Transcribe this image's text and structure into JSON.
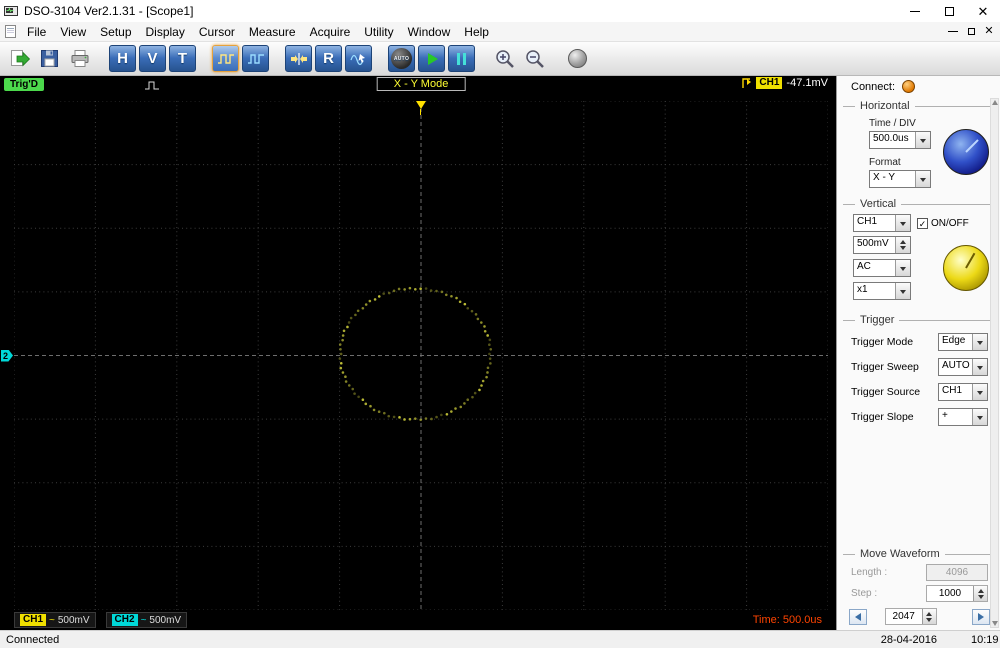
{
  "window": {
    "title": "DSO-3104 Ver2.1.31 - [Scope1]"
  },
  "menu": {
    "items": [
      "File",
      "View",
      "Setup",
      "Display",
      "Cursor",
      "Measure",
      "Acquire",
      "Utility",
      "Window",
      "Help"
    ]
  },
  "toolbar": {
    "h_label": "H",
    "v_label": "V",
    "t_label": "T",
    "r_label": "R",
    "auto_label": "AUTO"
  },
  "scope": {
    "trig_status": "Trig'D",
    "mode_label": "X - Y Mode",
    "trigger_readout": {
      "channel": "CH1",
      "value": "-47.1mV"
    },
    "marker2": "2",
    "channels": [
      {
        "label": "CH1",
        "coupling": "~",
        "volts": "500mV"
      },
      {
        "label": "CH2",
        "coupling": "~",
        "volts": "500mV"
      }
    ],
    "time_label": "Time: 500.0us",
    "grid": {
      "cols": 10,
      "rows": 8,
      "dot_color": "#3d3d3d",
      "center_color": "#6e6e6e",
      "bg": "#000000"
    },
    "waveform": {
      "type": "xy-ellipse",
      "color": "#c9c93a",
      "cx": 0.493,
      "cy": 0.497,
      "rx": 0.0925,
      "ry": 0.129,
      "points": 88
    }
  },
  "panel": {
    "connect_label": "Connect:",
    "horizontal": {
      "title": "Horizontal",
      "time_div_label": "Time / DIV",
      "time_div_value": "500.0us",
      "format_label": "Format",
      "format_value": "X - Y"
    },
    "vertical": {
      "title": "Vertical",
      "channel_value": "CH1",
      "onoff_label": "ON/OFF",
      "volts_value": "500mV",
      "coupling_value": "AC",
      "probe_value": "x1"
    },
    "trigger": {
      "title": "Trigger",
      "rows": [
        {
          "label": "Trigger Mode",
          "value": "Edge"
        },
        {
          "label": "Trigger Sweep",
          "value": "AUTO"
        },
        {
          "label": "Trigger Source",
          "value": "CH1"
        },
        {
          "label": "Trigger Slope",
          "value": "+"
        }
      ]
    },
    "move": {
      "title": "Move Waveform",
      "length_label": "Length :",
      "length_value": "4096",
      "step_label": "Step :",
      "step_value": "1000",
      "position_value": "2047"
    }
  },
  "statusbar": {
    "left": "Connected",
    "date": "28-04-2016",
    "time": "10:19"
  },
  "colors": {
    "ch1": "#f0e000",
    "ch2": "#00d8d8",
    "trig_ready": "#4cd94c",
    "time_text": "#ff4400",
    "connect_led": "#e07800"
  }
}
